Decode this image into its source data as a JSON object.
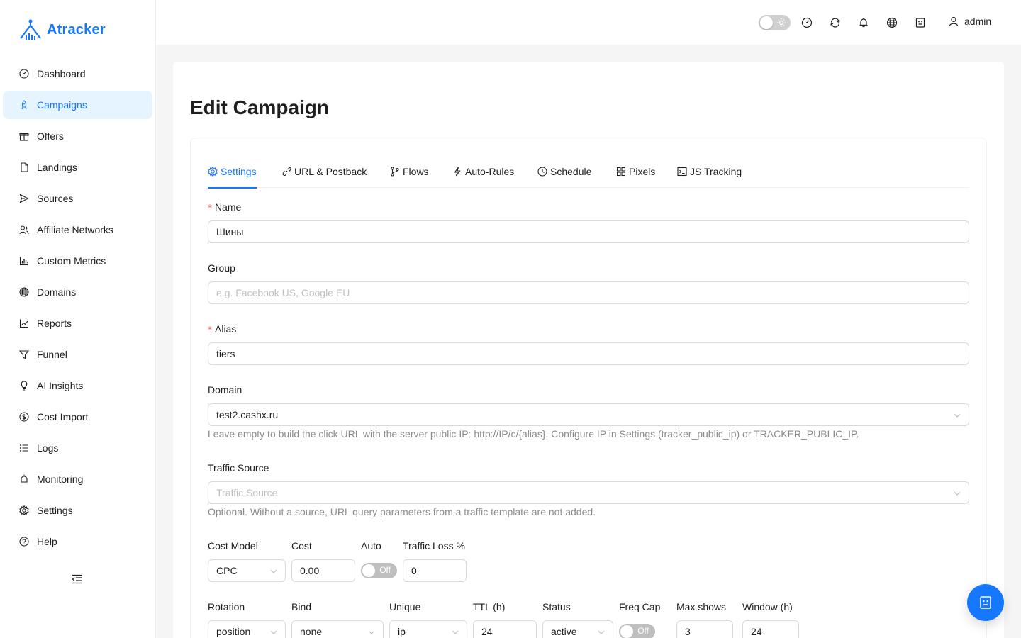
{
  "brand": {
    "name": "Atracker",
    "accent": "#1677ff"
  },
  "sidebar": {
    "items": [
      {
        "label": "Dashboard",
        "icon": "dashboard-icon"
      },
      {
        "label": "Campaigns",
        "icon": "rocket-icon",
        "active": true
      },
      {
        "label": "Offers",
        "icon": "gift-icon"
      },
      {
        "label": "Landings",
        "icon": "file-icon"
      },
      {
        "label": "Sources",
        "icon": "send-icon"
      },
      {
        "label": "Affiliate Networks",
        "icon": "team-icon"
      },
      {
        "label": "Custom Metrics",
        "icon": "bar-chart-icon"
      },
      {
        "label": "Domains",
        "icon": "globe-icon"
      },
      {
        "label": "Reports",
        "icon": "line-chart-icon"
      },
      {
        "label": "Funnel",
        "icon": "funnel-icon"
      },
      {
        "label": "AI Insights",
        "icon": "bulb-icon"
      },
      {
        "label": "Cost Import",
        "icon": "dollar-icon"
      },
      {
        "label": "Logs",
        "icon": "list-icon"
      },
      {
        "label": "Monitoring",
        "icon": "alert-icon"
      },
      {
        "label": "Settings",
        "icon": "gear-icon"
      },
      {
        "label": "Help",
        "icon": "question-icon"
      }
    ]
  },
  "header": {
    "user": "admin"
  },
  "page": {
    "title": "Edit Campaign"
  },
  "tabs": [
    {
      "label": "Settings",
      "icon": "gear-icon",
      "active": true
    },
    {
      "label": "URL & Postback",
      "icon": "link-icon"
    },
    {
      "label": "Flows",
      "icon": "branch-icon"
    },
    {
      "label": "Auto-Rules",
      "icon": "thunderbolt-icon"
    },
    {
      "label": "Schedule",
      "icon": "clock-icon"
    },
    {
      "label": "Pixels",
      "icon": "appstore-icon"
    },
    {
      "label": "JS Tracking",
      "icon": "code-icon"
    }
  ],
  "form": {
    "name": {
      "label": "Name",
      "value": "Шины"
    },
    "group": {
      "label": "Group",
      "placeholder": "e.g. Facebook US, Google EU"
    },
    "alias": {
      "label": "Alias",
      "value": "tiers"
    },
    "domain": {
      "label": "Domain",
      "value": "test2.cashx.ru",
      "help": "Leave empty to build the click URL with the server public IP: http://IP/c/{alias}. Configure IP in Settings (tracker_public_ip) or TRACKER_PUBLIC_IP."
    },
    "traffic_source": {
      "label": "Traffic Source",
      "placeholder": "Traffic Source",
      "help": "Optional. Without a source, URL query parameters from a traffic template are not added."
    },
    "cost_model": {
      "label": "Cost Model",
      "value": "CPC"
    },
    "cost": {
      "label": "Cost",
      "value": "0.00"
    },
    "auto": {
      "label": "Auto",
      "state": "Off"
    },
    "traffic_loss": {
      "label": "Traffic Loss %",
      "value": "0"
    },
    "rotation": {
      "label": "Rotation",
      "value": "position"
    },
    "bind": {
      "label": "Bind",
      "value": "none"
    },
    "unique": {
      "label": "Unique",
      "value": "ip"
    },
    "ttl": {
      "label": "TTL (h)",
      "value": "24"
    },
    "status": {
      "label": "Status",
      "value": "active"
    },
    "freq_cap": {
      "label": "Freq Cap",
      "state": "Off"
    },
    "max_shows": {
      "label": "Max shows",
      "value": "3"
    },
    "window": {
      "label": "Window (h)",
      "value": "24"
    }
  }
}
